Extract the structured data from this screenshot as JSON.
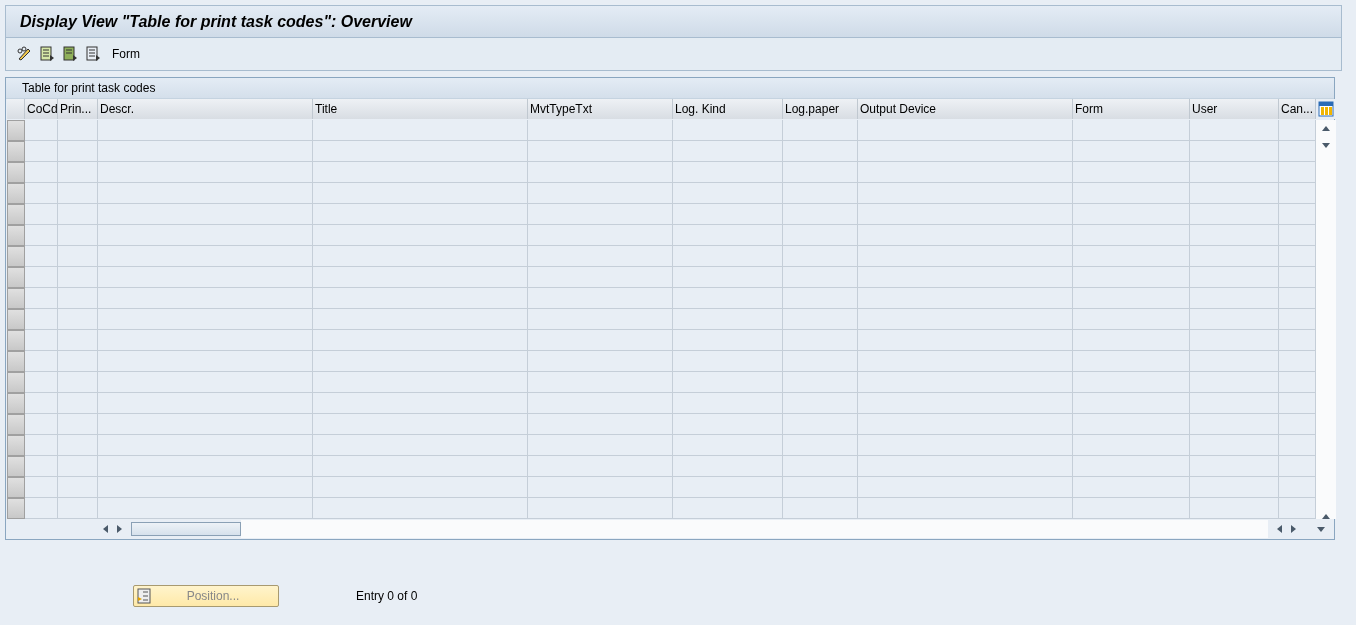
{
  "window": {
    "title": "Display View \"Table for print task codes\": Overview"
  },
  "toolbar": {
    "buttons": [
      {
        "label": "Form"
      }
    ]
  },
  "table": {
    "title": "Table for print task codes",
    "columns": [
      "CoCd",
      "Prin...",
      "Descr.",
      "Title",
      "MvtTypeTxt",
      "Log. Kind",
      "Log.paper",
      "Output Device",
      "Form",
      "User",
      "Can..."
    ]
  },
  "position_button": {
    "label": "Position...",
    "disabled": true
  },
  "entry_count": "Entry 0 of 0"
}
